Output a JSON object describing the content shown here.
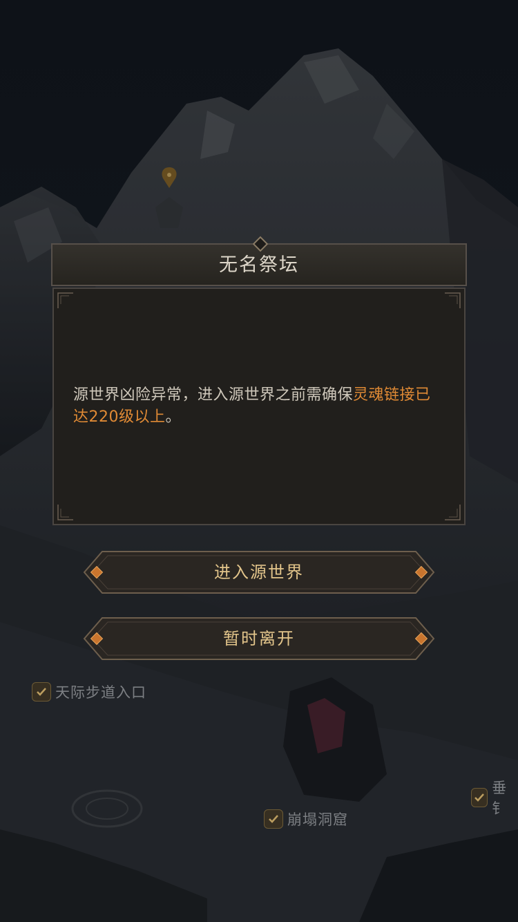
{
  "dialog": {
    "title": "无名祭坛",
    "message_parts": {
      "normal": "源世界凶险异常，进入源世界之前需确保",
      "highlight": "灵魂链接已达220级以上",
      "tail": "。"
    }
  },
  "buttons": {
    "enter": "进入源世界",
    "leave": "暂时离开"
  },
  "map_markers": [
    {
      "label": "天际步道入口"
    },
    {
      "label": "崩塌洞窟"
    },
    {
      "label": "垂钅"
    }
  ],
  "colors": {
    "highlight": "#e08a35",
    "button_text": "#e3c58b",
    "title_text": "#ddd6c9"
  }
}
